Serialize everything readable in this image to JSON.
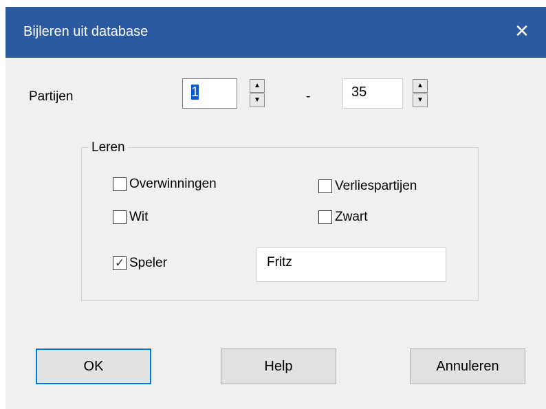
{
  "window": {
    "title": "Bijleren uit database",
    "close_glyph": "✕"
  },
  "range": {
    "label": "Partijen",
    "from_value": "1",
    "separator": "-",
    "to_value": "35"
  },
  "group": {
    "title": "Leren",
    "checkboxes": [
      {
        "label": "Overwinningen",
        "checked": false
      },
      {
        "label": "Verliespartijen",
        "checked": false
      },
      {
        "label": "Wit",
        "checked": false
      },
      {
        "label": "Zwart",
        "checked": false
      },
      {
        "label": "Speler",
        "checked": true
      }
    ],
    "player_name": "Fritz"
  },
  "buttons": {
    "ok": "OK",
    "help": "Help",
    "cancel": "Annuleren"
  },
  "icons": {
    "spin_up": "spin-up-arrow-icon",
    "spin_down": "spin-down-arrow-icon",
    "check": "checkmark-icon"
  },
  "colors": {
    "titlebar": "#2c5aa0",
    "client_bg": "#f0f0f0",
    "focus_border": "#0078d7",
    "selection": "#0a58d6"
  }
}
